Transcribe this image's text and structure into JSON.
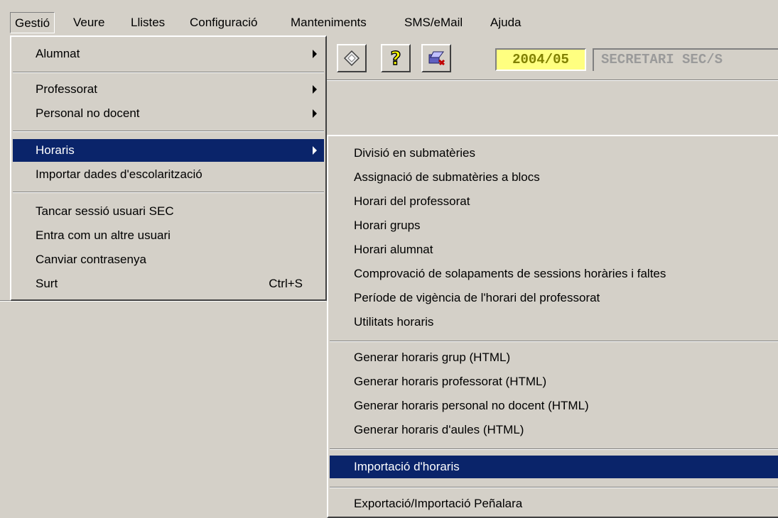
{
  "menubar": {
    "items": [
      {
        "label": "Gestió"
      },
      {
        "label": "Veure"
      },
      {
        "label": "Llistes"
      },
      {
        "label": "Configuració"
      },
      {
        "label": "Manteniments"
      },
      {
        "label": "SMS/eMail"
      },
      {
        "label": "Ajuda"
      }
    ]
  },
  "toolbar": {
    "year": "2004/05",
    "user": "SECRETARI    SEC/S"
  },
  "gestio_menu": {
    "items": [
      {
        "label": "Alumnat",
        "submenu": true
      },
      {
        "label": "Professorat",
        "submenu": true
      },
      {
        "label": "Personal no docent",
        "submenu": true
      },
      {
        "label": "Horaris",
        "submenu": true
      },
      {
        "label": "Importar dades d'escolarització"
      },
      {
        "label": "Tancar sessió usuari SEC"
      },
      {
        "label": "Entra com un altre usuari"
      },
      {
        "label": "Canviar contrasenya"
      },
      {
        "label": "Surt",
        "shortcut": "Ctrl+S"
      }
    ]
  },
  "horaris_menu": {
    "items": [
      {
        "label": "Divisió en submatèries"
      },
      {
        "label": "Assignació de submatèries a blocs"
      },
      {
        "label": "Horari del professorat"
      },
      {
        "label": "Horari grups"
      },
      {
        "label": "Horari alumnat"
      },
      {
        "label": "Comprovació de solapaments de sessions horàries i faltes"
      },
      {
        "label": "Període de vigència de l'horari del professorat"
      },
      {
        "label": "Utilitats horaris"
      },
      {
        "label": "Generar horaris grup (HTML)"
      },
      {
        "label": "Generar horaris professorat (HTML)"
      },
      {
        "label": "Generar horaris personal no docent (HTML)"
      },
      {
        "label": "Generar horaris d'aules (HTML)"
      },
      {
        "label": "Importació d'horaris"
      },
      {
        "label": "Exportació/Importació Peñalara"
      }
    ]
  },
  "colors": {
    "menu_bg": "#d4d0c8",
    "highlight": "#0a246a",
    "year_bg": "#ffff80"
  }
}
